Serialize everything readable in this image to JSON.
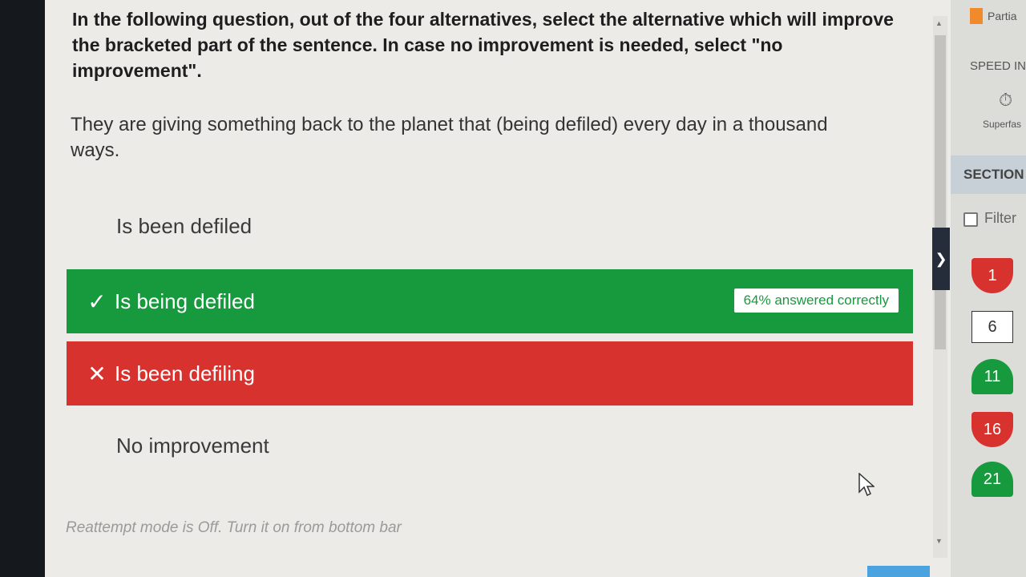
{
  "question": {
    "instruction": "In the following question, out of the four alternatives, select the alternative which will improve the bracketed part of the sentence. In case no improvement is needed, select \"no improvement\".",
    "sentence": "They are giving something back to the planet that (being defiled) every day in a thousand ways."
  },
  "options": [
    {
      "text": "Is been defiled",
      "state": "neutral"
    },
    {
      "text": "Is being defiled",
      "state": "correct",
      "mark_icon": "check-icon",
      "stat": "64% answered correctly"
    },
    {
      "text": "Is been defiling",
      "state": "wrong",
      "mark_icon": "cross-icon"
    },
    {
      "text": "No improvement",
      "state": "neutral"
    }
  ],
  "symbols": {
    "check": "✓",
    "cross": "✕",
    "collapse": "❯",
    "timer": "⏱"
  },
  "footer_note": "Reattempt mode is Off. Turn it on from bottom bar",
  "sidebar": {
    "partial_label": "Partia",
    "speed_label": "SPEED IN",
    "speed_value": "Superfas",
    "section_title": "SECTION",
    "filter_label": "Filter",
    "question_numbers": [
      {
        "num": "1",
        "status": "wrong"
      },
      {
        "num": "6",
        "status": "unattempted"
      },
      {
        "num": "11",
        "status": "correct"
      },
      {
        "num": "16",
        "status": "wrong"
      },
      {
        "num": "21",
        "status": "correct"
      }
    ]
  },
  "colors": {
    "correct": "#17993d",
    "wrong": "#d8322f",
    "accent": "#f08a2a"
  }
}
